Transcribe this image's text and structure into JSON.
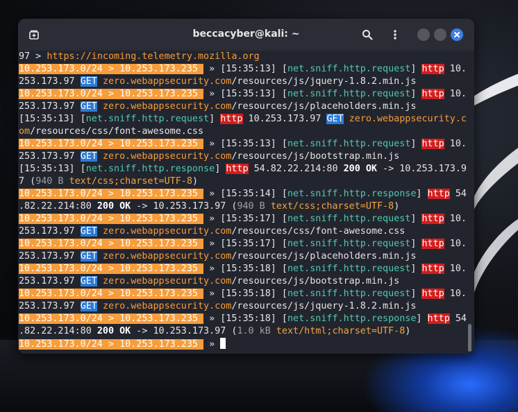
{
  "window": {
    "title": "beccacyber@kali: ~"
  },
  "icons": {
    "new_tab": "new-tab-icon",
    "search": "search-icon",
    "menu": "menu-icon",
    "minimize": "minimize-icon",
    "maximize": "maximize-icon",
    "close": "close-icon"
  },
  "colors": {
    "prompt_bg": "#f79d3b",
    "category": "#4ec9b0",
    "http_bg": "#d21e1e",
    "get_bg": "#2b7bd8",
    "host": "#f79d3b",
    "close_button": "#3d7fe0"
  },
  "terminal": {
    "lines": [
      [
        [
          "plain",
          "97 > "
        ],
        [
          "link",
          "https://incoming.telemetry.mozilla.org"
        ]
      ],
      [
        [
          "prompt",
          "10.253.173.0/24 > 10.253.173.235 "
        ],
        [
          "plain",
          " » [15:35:13] ["
        ],
        [
          "cat",
          "net.sniff.http.request"
        ],
        [
          "plain",
          "] "
        ],
        [
          "http",
          "http"
        ],
        [
          "plain",
          " 10."
        ]
      ],
      [
        [
          "plain",
          "253.173.97 "
        ],
        [
          "get",
          "GET"
        ],
        [
          "plain",
          " "
        ],
        [
          "host",
          "zero.webappsecurity.com"
        ],
        [
          "plain",
          "/resources/js/jquery-1.8.2.min.js"
        ]
      ],
      [
        [
          "prompt",
          "10.253.173.0/24 > 10.253.173.235 "
        ],
        [
          "plain",
          " » [15:35:13] ["
        ],
        [
          "cat",
          "net.sniff.http.request"
        ],
        [
          "plain",
          "] "
        ],
        [
          "http",
          "http"
        ],
        [
          "plain",
          " 10."
        ]
      ],
      [
        [
          "plain",
          "253.173.97 "
        ],
        [
          "get",
          "GET"
        ],
        [
          "plain",
          " "
        ],
        [
          "host",
          "zero.webappsecurity.com"
        ],
        [
          "plain",
          "/resources/js/placeholders.min.js"
        ]
      ],
      [
        [
          "plain",
          "[15:35:13] ["
        ],
        [
          "cat",
          "net.sniff.http.request"
        ],
        [
          "plain",
          "] "
        ],
        [
          "http",
          "http"
        ],
        [
          "plain",
          " 10.253.173.97 "
        ],
        [
          "get",
          "GET"
        ],
        [
          "plain",
          " "
        ],
        [
          "host",
          "zero.webappsecurity.c"
        ]
      ],
      [
        [
          "host",
          "om"
        ],
        [
          "plain",
          "/resources/css/font-awesome.css"
        ]
      ],
      [
        [
          "prompt",
          "10.253.173.0/24 > 10.253.173.235 "
        ],
        [
          "plain",
          " » [15:35:13] ["
        ],
        [
          "cat",
          "net.sniff.http.request"
        ],
        [
          "plain",
          "] "
        ],
        [
          "http",
          "http"
        ],
        [
          "plain",
          " 10."
        ]
      ],
      [
        [
          "plain",
          "253.173.97 "
        ],
        [
          "get",
          "GET"
        ],
        [
          "plain",
          " "
        ],
        [
          "host",
          "zero.webappsecurity.com"
        ],
        [
          "plain",
          "/resources/js/bootstrap.min.js"
        ]
      ],
      [
        [
          "plain",
          "[15:35:13] ["
        ],
        [
          "cat",
          "net.sniff.http.response"
        ],
        [
          "plain",
          "] "
        ],
        [
          "http",
          "http"
        ],
        [
          "plain",
          " 54.82.22.214:80 "
        ],
        [
          "ok",
          "200 OK"
        ],
        [
          "plain",
          " -> 10.253.173.9"
        ]
      ],
      [
        [
          "plain",
          "7 ("
        ],
        [
          "dim",
          "940 B"
        ],
        [
          "plain",
          " "
        ],
        [
          "mime",
          "text/css;charset=UTF-8"
        ],
        [
          "plain",
          ")"
        ]
      ],
      [
        [
          "prompt",
          "10.253.173.0/24 > 10.253.173.235 "
        ],
        [
          "plain",
          " » [15:35:14] ["
        ],
        [
          "cat",
          "net.sniff.http.response"
        ],
        [
          "plain",
          "] "
        ],
        [
          "http",
          "http"
        ],
        [
          "plain",
          " 54"
        ]
      ],
      [
        [
          "plain",
          ".82.22.214:80 "
        ],
        [
          "ok",
          "200 OK"
        ],
        [
          "plain",
          " -> 10.253.173.97 ("
        ],
        [
          "dim",
          "940 B"
        ],
        [
          "plain",
          " "
        ],
        [
          "mime",
          "text/css;charset=UTF-8"
        ],
        [
          "plain",
          ")"
        ]
      ],
      [
        [
          "prompt",
          "10.253.173.0/24 > 10.253.173.235 "
        ],
        [
          "plain",
          " » [15:35:17] ["
        ],
        [
          "cat",
          "net.sniff.http.request"
        ],
        [
          "plain",
          "] "
        ],
        [
          "http",
          "http"
        ],
        [
          "plain",
          " 10."
        ]
      ],
      [
        [
          "plain",
          "253.173.97 "
        ],
        [
          "get",
          "GET"
        ],
        [
          "plain",
          " "
        ],
        [
          "host",
          "zero.webappsecurity.com"
        ],
        [
          "plain",
          "/resources/css/font-awesome.css"
        ]
      ],
      [
        [
          "prompt",
          "10.253.173.0/24 > 10.253.173.235 "
        ],
        [
          "plain",
          " » [15:35:17] ["
        ],
        [
          "cat",
          "net.sniff.http.request"
        ],
        [
          "plain",
          "] "
        ],
        [
          "http",
          "http"
        ],
        [
          "plain",
          " 10."
        ]
      ],
      [
        [
          "plain",
          "253.173.97 "
        ],
        [
          "get",
          "GET"
        ],
        [
          "plain",
          " "
        ],
        [
          "host",
          "zero.webappsecurity.com"
        ],
        [
          "plain",
          "/resources/js/placeholders.min.js"
        ]
      ],
      [
        [
          "prompt",
          "10.253.173.0/24 > 10.253.173.235 "
        ],
        [
          "plain",
          " » [15:35:18] ["
        ],
        [
          "cat",
          "net.sniff.http.request"
        ],
        [
          "plain",
          "] "
        ],
        [
          "http",
          "http"
        ],
        [
          "plain",
          " 10."
        ]
      ],
      [
        [
          "plain",
          "253.173.97 "
        ],
        [
          "get",
          "GET"
        ],
        [
          "plain",
          " "
        ],
        [
          "host",
          "zero.webappsecurity.com"
        ],
        [
          "plain",
          "/resources/js/bootstrap.min.js"
        ]
      ],
      [
        [
          "prompt",
          "10.253.173.0/24 > 10.253.173.235 "
        ],
        [
          "plain",
          " » [15:35:18] ["
        ],
        [
          "cat",
          "net.sniff.http.request"
        ],
        [
          "plain",
          "] "
        ],
        [
          "http",
          "http"
        ],
        [
          "plain",
          " 10."
        ]
      ],
      [
        [
          "plain",
          "253.173.97 "
        ],
        [
          "get",
          "GET"
        ],
        [
          "plain",
          " "
        ],
        [
          "host",
          "zero.webappsecurity.com"
        ],
        [
          "plain",
          "/resources/js/jquery-1.8.2.min.js"
        ]
      ],
      [
        [
          "prompt",
          "10.253.173.0/24 > 10.253.173.235 "
        ],
        [
          "plain",
          " » [15:35:18] ["
        ],
        [
          "cat",
          "net.sniff.http.response"
        ],
        [
          "plain",
          "] "
        ],
        [
          "http",
          "http"
        ],
        [
          "plain",
          " 54"
        ]
      ],
      [
        [
          "plain",
          ".82.22.214:80 "
        ],
        [
          "ok",
          "200 OK"
        ],
        [
          "plain",
          " -> 10.253.173.97 ("
        ],
        [
          "dim",
          "1.0 kB"
        ],
        [
          "plain",
          " "
        ],
        [
          "mime",
          "text/html;charset=UTF-8"
        ],
        [
          "plain",
          ")"
        ]
      ],
      [
        [
          "prompt",
          "10.253.173.0/24 > 10.253.173.235 "
        ],
        [
          "plain",
          " » "
        ]
      ]
    ]
  }
}
